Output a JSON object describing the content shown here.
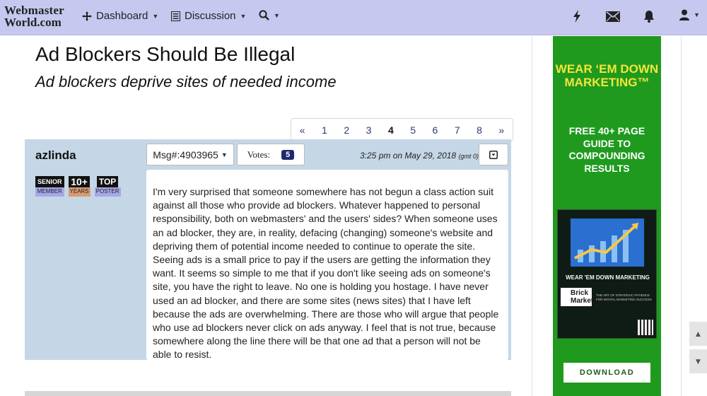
{
  "logo": {
    "line1": "Webmaster",
    "line2": "World.com"
  },
  "nav": {
    "dashboard": "Dashboard",
    "discussion": "Discussion"
  },
  "thread": {
    "title": "Ad Blockers Should Be Illegal",
    "subtitle": "Ad blockers deprive sites of needed income"
  },
  "pager": {
    "prev": "«",
    "pages": [
      "1",
      "2",
      "3",
      "4",
      "5",
      "6",
      "7",
      "8"
    ],
    "current": "4",
    "next": "»"
  },
  "post": {
    "author": "azlinda",
    "badges": [
      {
        "top": "SENIOR",
        "bottom": "MEMBER"
      },
      {
        "top": "10+",
        "bottom": "YEARS"
      },
      {
        "top": "TOP",
        "bottom": "POSTER"
      }
    ],
    "msg_label": "Msg#:4903965",
    "votes_label": "Votes:",
    "votes_count": "5",
    "time": "3:25 pm on May 29, 2018",
    "gmt": "(gmt 0)",
    "body": "I'm very surprised that someone somewhere has not begun a class action suit against all those who provide ad blockers. Whatever happened to personal responsibility, both on webmasters' and the users' sides? When someone uses an ad blocker, they are, in reality, defacing (changing) someone's website and depriving them of potential income needed to continue to operate the site. Seeing ads is a small price to pay if the users are getting the information they want. It seems so simple to me that if you don't like seeing ads on someone's site, you have the right to leave. No one is holding you hostage. I have never used an ad blocker, and there are some sites (news sites) that I have left because the ads are overwhelming. There are those who will argue that people who use ad blockers never click on ads anyway. I feel that is not true, because somewhere along the line there will be that one ad that a person will not be able to resist."
  },
  "ad": {
    "headline": "WEAR ‘EM DOWN MARKETING™",
    "subhead": "FREE 40+ PAGE GUIDE TO COMPOUNDING RESULTS",
    "book_title": "WEAR 'EM DOWN MARKETING",
    "book_logo": "Brick Marketing",
    "book_tag": "THE ART OF STRATEGIC PATIENCE FOR DIGITAL MARKETING SUCCESS",
    "button": "DOWNLOAD"
  },
  "colors": {
    "topbar": "#c6c8ef",
    "post_bg": "#c5d7e6",
    "ad_green": "#1f9a1e",
    "ad_yellow": "#f5e53a",
    "votes_badge": "#1f2a6e"
  },
  "icons": {
    "dashboard": "move-icon",
    "discussion": "list-icon",
    "search": "search-icon",
    "lightning": "lightning-icon",
    "mail": "mail-icon",
    "bell": "bell-icon",
    "user": "user-icon",
    "collapse": "collapse-icon",
    "scroll_up": "arrow-up-icon",
    "scroll_down": "arrow-down-icon"
  }
}
